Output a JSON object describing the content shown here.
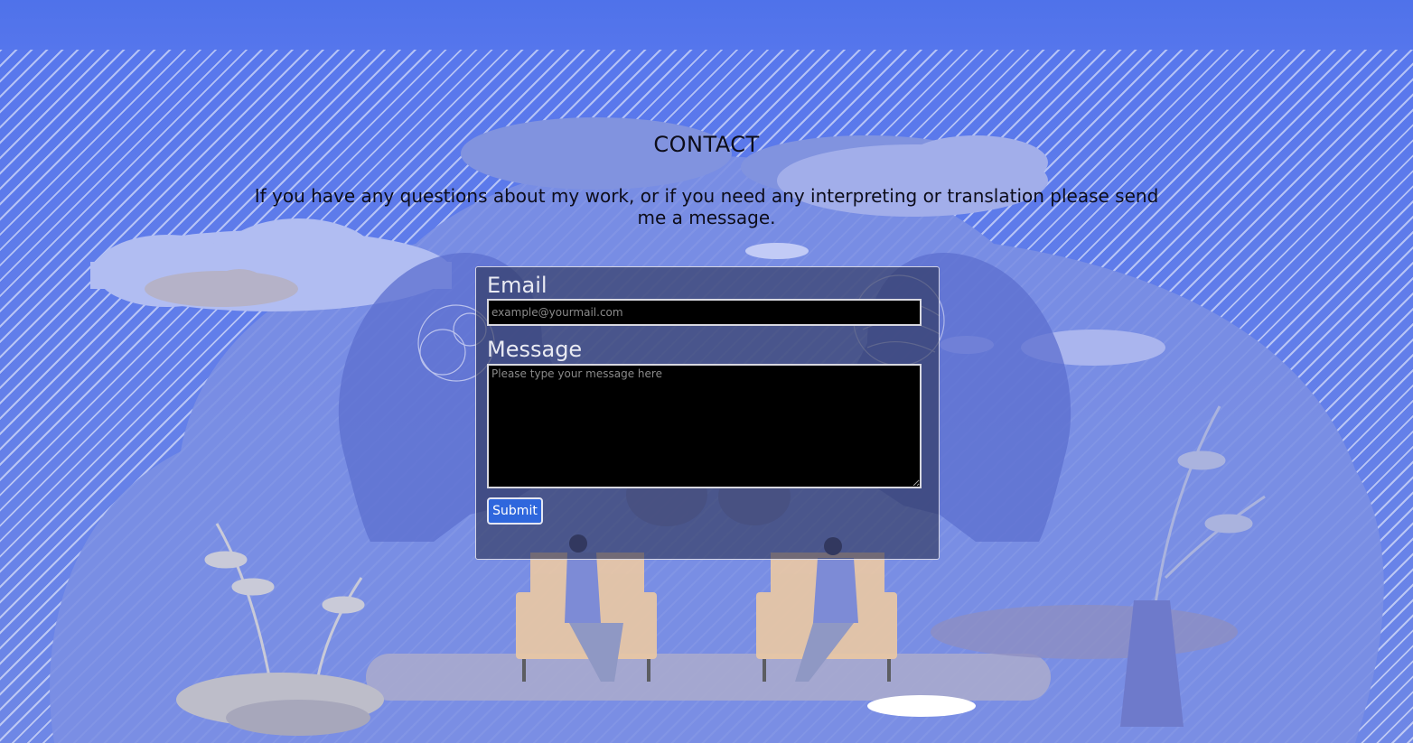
{
  "page": {
    "title": "CONTACT",
    "intro": "If you have any questions about my work, or if you need any interpreting or translation please send me a message."
  },
  "form": {
    "email_label": "Email",
    "email_placeholder": "example@yourmail.com",
    "email_value": "",
    "message_label": "Message",
    "message_placeholder": "Please type your message here",
    "message_value": "",
    "submit_label": "Submit"
  },
  "colors": {
    "background": "#5273ea",
    "form_panel": "#2d3455",
    "submit_button": "#2f67dd"
  }
}
